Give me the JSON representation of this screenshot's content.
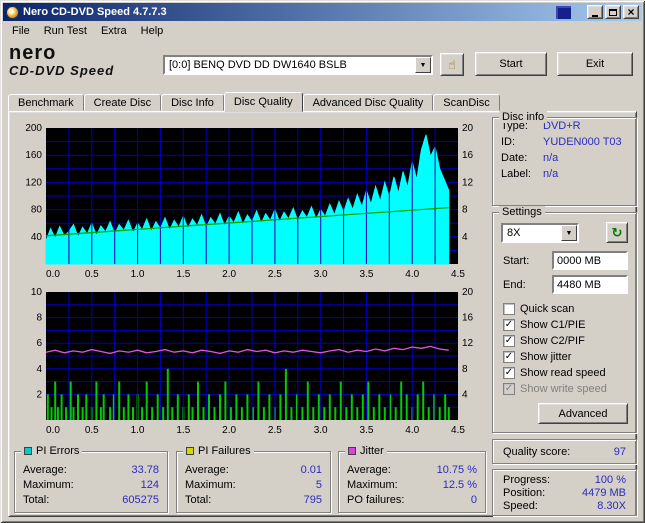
{
  "window": {
    "title": "Nero CD-DVD Speed 4.7.7.3"
  },
  "menu": {
    "items": [
      "File",
      "Run Test",
      "Extra",
      "Help"
    ]
  },
  "toolbar": {
    "logo_line1": "nero",
    "logo_line2": "CD-DVD Speed",
    "drive_selector": "[0:0]  BENQ DVD DD DW1640 BSLB",
    "start_button": "Start",
    "exit_button": "Exit"
  },
  "icons": {
    "close": "×",
    "dropdown_arrow": "▼",
    "hand": "☝",
    "refresh": "↻",
    "check": "✓"
  },
  "colors": {
    "value_text": "#2b2bc0"
  },
  "tabs": {
    "items": [
      "Benchmark",
      "Create Disc",
      "Disc Info",
      "Disc Quality",
      "Advanced Disc Quality",
      "ScanDisc"
    ],
    "active": "Disc Quality"
  },
  "disc_info": {
    "title": "Disc info",
    "rows": [
      {
        "label": "Type:",
        "value": "DVD+R"
      },
      {
        "label": "ID:",
        "value": "YUDEN000 T03"
      },
      {
        "label": "Date:",
        "value": "n/a"
      },
      {
        "label": "Label:",
        "value": "n/a"
      }
    ]
  },
  "settings": {
    "title": "Settings",
    "speed": "8X",
    "start_label": "Start:",
    "start_value": "0000 MB",
    "end_label": "End:",
    "end_value": "4480 MB",
    "checkboxes": [
      {
        "label": "Quick scan",
        "checked": false,
        "disabled": false
      },
      {
        "label": "Show C1/PIE",
        "checked": true,
        "disabled": false
      },
      {
        "label": "Show C2/PIF",
        "checked": true,
        "disabled": false
      },
      {
        "label": "Show jitter",
        "checked": true,
        "disabled": false
      },
      {
        "label": "Show read speed",
        "checked": true,
        "disabled": false
      },
      {
        "label": "Show write speed",
        "checked": true,
        "disabled": true
      }
    ],
    "advanced_button": "Advanced"
  },
  "quality": {
    "label": "Quality score:",
    "value": "97"
  },
  "progress": {
    "rows": [
      {
        "label": "Progress:",
        "value": "100 %"
      },
      {
        "label": "Position:",
        "value": "4479 MB"
      },
      {
        "label": "Speed:",
        "value": "8.30X"
      }
    ]
  },
  "results": [
    {
      "title": "PI Errors",
      "color": "#00cccc",
      "rows": [
        {
          "label": "Average:",
          "value": "33.78"
        },
        {
          "label": "Maximum:",
          "value": "124"
        },
        {
          "label": "Total:",
          "value": "605275"
        }
      ]
    },
    {
      "title": "PI Failures",
      "color": "#d8d800",
      "rows": [
        {
          "label": "Average:",
          "value": "0.01"
        },
        {
          "label": "Maximum:",
          "value": "5"
        },
        {
          "label": "Total:",
          "value": "795"
        }
      ]
    },
    {
      "title": "Jitter",
      "color": "#dd44dd",
      "rows": [
        {
          "label": "Average:",
          "value": "10.75 %"
        },
        {
          "label": "Maximum:",
          "value": "12.5 %"
        },
        {
          "label": "PO failures:",
          "value": "0"
        }
      ]
    }
  ],
  "chart_data": [
    {
      "type": "area",
      "title": "PI Errors / Read speed",
      "x_min": 0,
      "x_max": 4.5,
      "x_grid_step": 0.25,
      "x_ticks": [
        "0.0",
        "0.5",
        "1.0",
        "1.5",
        "2.0",
        "2.5",
        "3.0",
        "3.5",
        "4.0",
        "4.5"
      ],
      "grid_color": "#0000c0",
      "bg_color": "#000000",
      "left_axis": {
        "min": 0,
        "max": 200,
        "ticks": [
          40,
          80,
          120,
          160,
          200
        ],
        "grid_step": 20
      },
      "right_axis": {
        "min": 0,
        "max": 20,
        "ticks": [
          4,
          8,
          12,
          16,
          20
        ]
      },
      "series": [
        {
          "name": "PI Errors",
          "kind": "area",
          "color": "#00ffff",
          "axis": "left",
          "x_start": 0,
          "x_step": 0.05,
          "values": [
            34,
            52,
            38,
            55,
            41,
            48,
            58,
            40,
            54,
            44,
            60,
            42,
            56,
            47,
            62,
            44,
            58,
            49,
            64,
            46,
            60,
            50,
            66,
            48,
            62,
            52,
            68,
            50,
            64,
            54,
            70,
            52,
            66,
            56,
            72,
            54,
            68,
            58,
            74,
            56,
            70,
            60,
            76,
            58,
            72,
            62,
            78,
            60,
            74,
            64,
            80,
            62,
            76,
            66,
            82,
            64,
            78,
            68,
            84,
            66,
            80,
            70,
            88,
            72,
            92,
            76,
            96,
            80,
            102,
            84,
            108,
            88,
            114,
            92,
            120,
            98,
            128,
            104,
            136,
            112,
            150,
            124,
            168,
            190,
            158,
            172,
            140,
            124,
            108
          ]
        },
        {
          "name": "Read speed",
          "kind": "line",
          "color": "#00aa00",
          "axis": "right",
          "x": [
            0,
            4.4
          ],
          "values": [
            4.15,
            8.3
          ]
        }
      ]
    },
    {
      "type": "bar",
      "title": "PI Failures / Jitter",
      "x_min": 0,
      "x_max": 4.5,
      "x_grid_step": 0.25,
      "x_ticks": [
        "0.0",
        "0.5",
        "1.0",
        "1.5",
        "2.0",
        "2.5",
        "3.0",
        "3.5",
        "4.0",
        "4.5"
      ],
      "grid_color": "#0000c0",
      "bg_color": "#000000",
      "left_axis": {
        "min": 0,
        "max": 10,
        "ticks": [
          2,
          4,
          6,
          8,
          10
        ],
        "grid_step": 1
      },
      "right_axis": {
        "min": 0,
        "max": 20,
        "ticks": [
          4,
          8,
          12,
          16,
          20
        ]
      },
      "series": [
        {
          "name": "PI Failures",
          "kind": "bars",
          "color": "#00cc00",
          "axis": "left",
          "points": [
            [
              0.02,
              2
            ],
            [
              0.06,
              1
            ],
            [
              0.1,
              3
            ],
            [
              0.13,
              1
            ],
            [
              0.17,
              2
            ],
            [
              0.22,
              1
            ],
            [
              0.27,
              3
            ],
            [
              0.3,
              1
            ],
            [
              0.35,
              2
            ],
            [
              0.4,
              1
            ],
            [
              0.44,
              2
            ],
            [
              0.5,
              1
            ],
            [
              0.55,
              3
            ],
            [
              0.6,
              1
            ],
            [
              0.63,
              2
            ],
            [
              0.7,
              1
            ],
            [
              0.74,
              2
            ],
            [
              0.8,
              3
            ],
            [
              0.85,
              1
            ],
            [
              0.9,
              2
            ],
            [
              0.95,
              1
            ],
            [
              1.0,
              2
            ],
            [
              1.05,
              1
            ],
            [
              1.1,
              3
            ],
            [
              1.16,
              1
            ],
            [
              1.22,
              2
            ],
            [
              1.28,
              1
            ],
            [
              1.33,
              4
            ],
            [
              1.38,
              1
            ],
            [
              1.44,
              2
            ],
            [
              1.5,
              1
            ],
            [
              1.56,
              2
            ],
            [
              1.6,
              1
            ],
            [
              1.66,
              3
            ],
            [
              1.72,
              1
            ],
            [
              1.78,
              2
            ],
            [
              1.84,
              1
            ],
            [
              1.9,
              2
            ],
            [
              1.96,
              3
            ],
            [
              2.02,
              1
            ],
            [
              2.08,
              2
            ],
            [
              2.14,
              1
            ],
            [
              2.2,
              2
            ],
            [
              2.26,
              1
            ],
            [
              2.32,
              3
            ],
            [
              2.38,
              1
            ],
            [
              2.44,
              2
            ],
            [
              2.5,
              1
            ],
            [
              2.56,
              2
            ],
            [
              2.62,
              4
            ],
            [
              2.68,
              1
            ],
            [
              2.74,
              2
            ],
            [
              2.8,
              1
            ],
            [
              2.86,
              3
            ],
            [
              2.92,
              1
            ],
            [
              2.98,
              2
            ],
            [
              3.04,
              1
            ],
            [
              3.1,
              2
            ],
            [
              3.16,
              1
            ],
            [
              3.22,
              3
            ],
            [
              3.28,
              1
            ],
            [
              3.34,
              2
            ],
            [
              3.4,
              1
            ],
            [
              3.46,
              2
            ],
            [
              3.52,
              3
            ],
            [
              3.58,
              1
            ],
            [
              3.64,
              2
            ],
            [
              3.7,
              1
            ],
            [
              3.76,
              2
            ],
            [
              3.82,
              1
            ],
            [
              3.88,
              3
            ],
            [
              3.94,
              2
            ],
            [
              4.0,
              1
            ],
            [
              4.06,
              2
            ],
            [
              4.12,
              3
            ],
            [
              4.18,
              1
            ],
            [
              4.24,
              2
            ],
            [
              4.3,
              1
            ],
            [
              4.36,
              2
            ],
            [
              4.4,
              1
            ]
          ]
        },
        {
          "name": "Jitter",
          "kind": "line",
          "color": "#dd55dd",
          "axis": "right",
          "x_start": 0,
          "x_step": 0.1,
          "values": [
            10.6,
            10.9,
            10.5,
            10.8,
            10.6,
            11.0,
            10.7,
            10.4,
            10.8,
            10.6,
            10.9,
            10.5,
            10.7,
            11.0,
            10.6,
            10.8,
            10.5,
            10.9,
            10.7,
            10.4,
            10.8,
            10.6,
            11.0,
            10.7,
            10.9,
            10.5,
            10.8,
            10.6,
            10.9,
            10.7,
            10.5,
            10.8,
            11.0,
            10.6,
            10.9,
            10.7,
            11.1,
            10.8,
            11.2,
            11.0,
            11.4,
            11.2,
            11.5,
            11.1,
            10.9
          ]
        }
      ]
    }
  ]
}
